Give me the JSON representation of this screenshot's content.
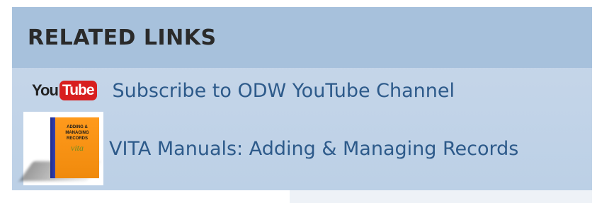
{
  "panel": {
    "title": "RELATED LINKS",
    "links": [
      {
        "label": "Subscribe to ODW YouTube Channel",
        "icon": "youtube-logo-icon",
        "logo": {
          "you": "You",
          "tube": "Tube"
        }
      },
      {
        "label": "VITA Manuals: Adding & Managing Records",
        "icon": "vita-manual-book-icon",
        "book": {
          "line1": "ADDING &",
          "line2": "MANAGING",
          "line3": "RECORDS",
          "brand": "vita"
        }
      }
    ]
  },
  "colors": {
    "header_bg": "#a7c1dc",
    "panel_bg": "#c9d8ea",
    "link": "#2d5a8a",
    "youtube_red": "#d81f1f",
    "book_orange": "#f5901a"
  }
}
